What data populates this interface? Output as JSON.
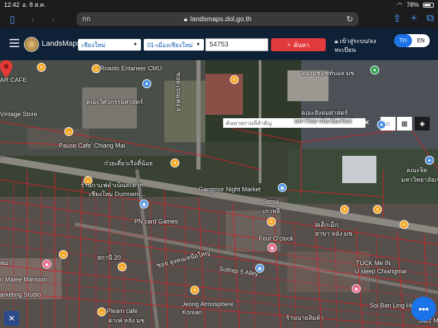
{
  "status": {
    "time": "12:42",
    "date": "อ. 8 ส.ค.",
    "battery": "78%",
    "battery_level": 0.78
  },
  "browser": {
    "tab_title": "กก",
    "url": "landsmaps.dol.go.th",
    "icons": [
      "sidebar-icon",
      "back-icon",
      "forward-icon",
      "reload-icon",
      "share-icon",
      "new-tab-icon",
      "tabs-icon"
    ]
  },
  "app": {
    "name": "LandsMaps",
    "province": "เชียงใหม่",
    "district": "01-เมืองเชียงใหม่",
    "parcel_number": "54753",
    "search_label": "ค้นหา",
    "login_label": "เข้าสู่ระบบ/ลงทะเบียน",
    "lang_th": "TH",
    "lang_en": "EN"
  },
  "map": {
    "landmark_placeholder": "ค้นหาสถานที่สำคัญ",
    "labels": [
      "Roasto Entaneer CMU",
      "AR CAFE",
      "ซอย เรณเฟง 4",
      "คณะวิศวกรรมศาสตร์",
      "Vintage Store",
      "Pause Cafe’ Chiang Mai",
      "ก๋วยเตี๋ยวเรือตี๋น้อย",
      "ร้านกาแฟดำเนินสะดวก",
      "เชียงใหม่ Dumnern...",
      "Gangmor Night Market",
      "Seoul",
      "เกาหลี",
      "PN card Games",
      "Four O’clock",
      "สถานี 20",
      "ซอย ลุงคนเหนือใหญ่",
      "n Malee Mansion",
      "arketing Studio",
      "Suthep 5 Alley",
      "Jeong Atmosphere",
      "Korean",
      "Pleam cafe",
      "คาเฟ่ หลัง มช",
      "สนามซอฟท์บอล มช",
      "คณะสังคมศาสตร์",
      "มหาวิทยาลัยเชียงใหม่",
      "คณะจิต",
      "มหาวิทยาลัยเชีย",
      "สเต็กเม็ก",
      "สาขา หลัง มช",
      "TUCK Me IN",
      "U sleep Chiangmai",
      "Soi Ban Ling Hi",
      "ร้านนายสิมค้า",
      "Jazz Me",
      "หม่"
    ]
  }
}
